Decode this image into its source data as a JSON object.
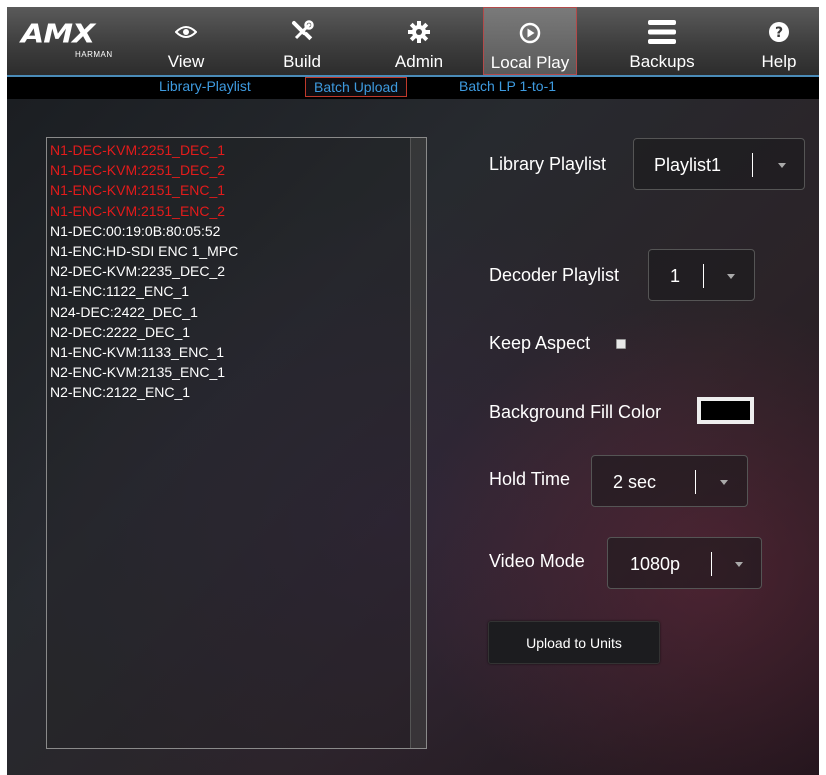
{
  "logo": {
    "brand": "AMX",
    "subtext": "HARMAN"
  },
  "nav": [
    {
      "label": "View",
      "icon": "eye-icon"
    },
    {
      "label": "Build",
      "icon": "tools-icon"
    },
    {
      "label": "Admin",
      "icon": "gear-icon"
    },
    {
      "label": "Local Play",
      "icon": "play-circle-icon",
      "active": true
    },
    {
      "label": "Backups",
      "icon": "menu-lines-icon"
    },
    {
      "label": "Help",
      "icon": "help-icon"
    }
  ],
  "subnav": [
    {
      "label": "Library-Playlist"
    },
    {
      "label": "Batch Upload",
      "active": true
    },
    {
      "label": "Batch LP 1-to-1"
    }
  ],
  "units": [
    {
      "name": "N1-DEC-KVM:2251_DEC_1",
      "selected": true
    },
    {
      "name": "N1-DEC-KVM:2251_DEC_2",
      "selected": true
    },
    {
      "name": "N1-ENC-KVM:2151_ENC_1",
      "selected": true
    },
    {
      "name": "N1-ENC-KVM:2151_ENC_2",
      "selected": true
    },
    {
      "name": "N1-DEC:00:19:0B:80:05:52",
      "selected": false
    },
    {
      "name": "N1-ENC:HD-SDI ENC 1_MPC",
      "selected": false
    },
    {
      "name": "N2-DEC-KVM:2235_DEC_2",
      "selected": false
    },
    {
      "name": "N1-ENC:1122_ENC_1",
      "selected": false
    },
    {
      "name": "N24-DEC:2422_DEC_1",
      "selected": false
    },
    {
      "name": "N2-DEC:2222_DEC_1",
      "selected": false
    },
    {
      "name": "N1-ENC-KVM:1133_ENC_1",
      "selected": false
    },
    {
      "name": "N2-ENC-KVM:2135_ENC_1",
      "selected": false
    },
    {
      "name": "N2-ENC:2122_ENC_1",
      "selected": false
    }
  ],
  "form": {
    "library_playlist": {
      "label": "Library Playlist",
      "value": "Playlist1"
    },
    "decoder_playlist": {
      "label": "Decoder Playlist",
      "value": "1"
    },
    "keep_aspect": {
      "label": "Keep Aspect",
      "checked": false
    },
    "background_fill": {
      "label": "Background Fill Color",
      "color": "#000000"
    },
    "hold_time": {
      "label": "Hold Time",
      "value": "2 sec"
    },
    "video_mode": {
      "label": "Video Mode",
      "value": "1080p"
    },
    "upload_label": "Upload to Units"
  },
  "colors": {
    "accent_blue": "#3e9be0",
    "selected_red": "#e31b1b",
    "active_border": "#b34a4a"
  }
}
